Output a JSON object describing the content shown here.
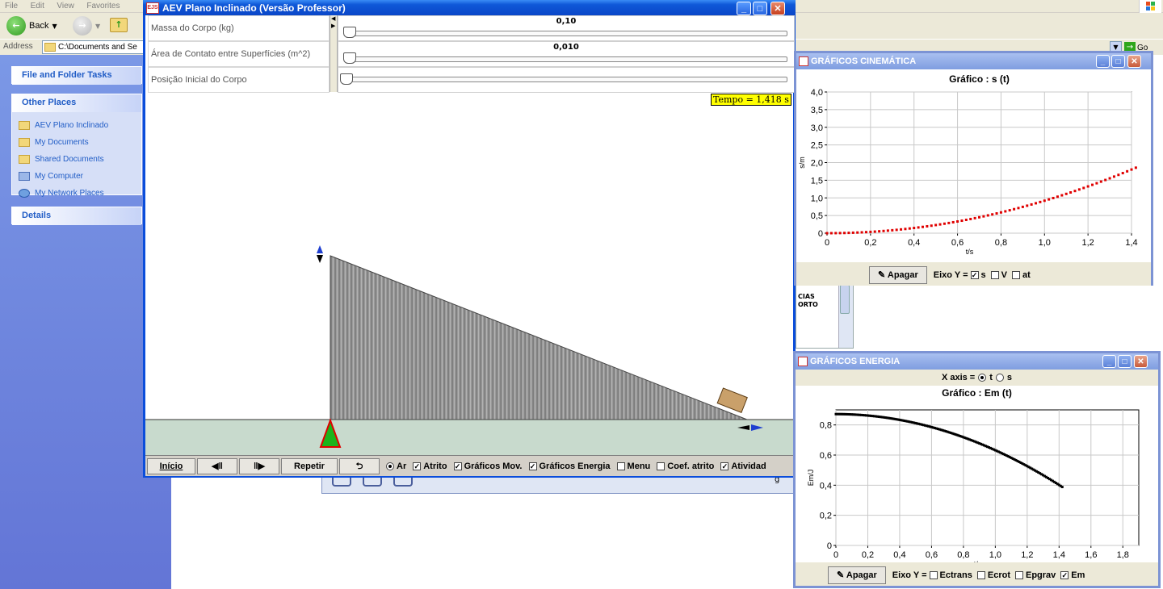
{
  "explorer": {
    "menu": [
      "File",
      "Edit",
      "View",
      "Favorites"
    ],
    "back_label": "Back",
    "address_label": "Address",
    "address_value": "C:\\Documents and Se",
    "go_label": "Go",
    "tasks_header": "File and Folder Tasks",
    "other_places_header": "Other Places",
    "other_places": [
      "AEV Plano Inclinado",
      "My Documents",
      "Shared Documents",
      "My Computer",
      "My Network Places"
    ],
    "details_header": "Details",
    "behind_text_1": "CIAS",
    "behind_text_2": "ORTO"
  },
  "main": {
    "title": "AEV Plano Inclinado (Versão Professor)",
    "params": [
      {
        "label": "Massa do Corpo (kg)",
        "value": "0,10",
        "fraction": 0.0
      },
      {
        "label": "Área de Contato entre Superfícies (m^2)",
        "value": "0,010",
        "fraction": 0.0
      },
      {
        "label": "Posição Inicial do Corpo",
        "value": "",
        "fraction": 0.0
      }
    ],
    "tempo": "Tempo = 1,418 s",
    "buttons": {
      "inicio": "Início",
      "step_back": "◀‖",
      "step_fwd": "‖▶",
      "repetir": "Repetir",
      "undo": "⮌"
    },
    "checks": [
      {
        "label": "Ar",
        "kind": "radio",
        "checked": true
      },
      {
        "label": "Atrito",
        "kind": "check",
        "checked": true
      },
      {
        "label": "Gráficos Mov.",
        "kind": "check",
        "checked": true
      },
      {
        "label": "Gráficos Energia",
        "kind": "check",
        "checked": true
      },
      {
        "label": "Menu",
        "kind": "check",
        "checked": false
      },
      {
        "label": "Coef. atrito",
        "kind": "check",
        "checked": false
      },
      {
        "label": "Atividad",
        "kind": "check",
        "checked": true
      }
    ],
    "behind_right_text": "g"
  },
  "kinematics": {
    "title": "GRÁFICOS CINEMÁTICA",
    "apagar": "Apagar",
    "eixo_label": "Eixo Y =",
    "options": [
      {
        "label": "s",
        "checked": true
      },
      {
        "label": "V",
        "checked": false
      },
      {
        "label": "at",
        "checked": false
      }
    ]
  },
  "energy": {
    "title": "GRÁFICOS ENERGIA",
    "xaxis_label": "X axis =",
    "xaxis_options": [
      {
        "label": "t",
        "selected": true
      },
      {
        "label": "s",
        "selected": false
      }
    ],
    "apagar": "Apagar",
    "eixo_label": "Eixo Y =",
    "options": [
      {
        "label": "Ectrans",
        "checked": false
      },
      {
        "label": "Ecrot",
        "checked": false
      },
      {
        "label": "Epgrav",
        "checked": false
      },
      {
        "label": "Em",
        "checked": true
      }
    ]
  },
  "colors": {
    "xp_blue": "#0a4ddb",
    "series_kin": "#e00000",
    "series_energy": "#000000",
    "tempo_bg": "#ffff00",
    "ground": "#c8dacd"
  },
  "chart_data": [
    {
      "type": "scatter",
      "title": "Gráfico : s  (t)",
      "xlabel": "t/s",
      "ylabel": "s/m",
      "xlim": [
        0,
        1.4
      ],
      "ylim": [
        0,
        4.0
      ],
      "xticks": [
        "0",
        "0,2",
        "0,4",
        "0,6",
        "0,8",
        "1,0",
        "1,2",
        "1,4"
      ],
      "yticks": [
        "0",
        "0,5",
        "1,0",
        "1,5",
        "2,0",
        "2,5",
        "3,0",
        "3,5",
        "4,0"
      ],
      "grid": true,
      "series": [
        {
          "x_start": 0,
          "x_end": 1.42,
          "step": 0.02,
          "curve": "s = 0.92 t^2"
        }
      ]
    },
    {
      "type": "scatter",
      "title": "Gráfico :  Em  (t)",
      "xlabel": "t/s",
      "ylabel": "Em/J",
      "xlim": [
        0,
        1.9
      ],
      "ylim": [
        0,
        0.9
      ],
      "xticks": [
        "0",
        "0,2",
        "0,4",
        "0,6",
        "0,8",
        "1,0",
        "1,2",
        "1,4",
        "1,6",
        "1,8"
      ],
      "yticks": [
        "0",
        "0,2",
        "0,4",
        "0,6",
        "0,8"
      ],
      "grid": true,
      "series": [
        {
          "x_start": 0,
          "x_end": 1.42,
          "step": 0.01,
          "curve": "Em = 0.872 - 0.24 t^2"
        }
      ]
    }
  ]
}
